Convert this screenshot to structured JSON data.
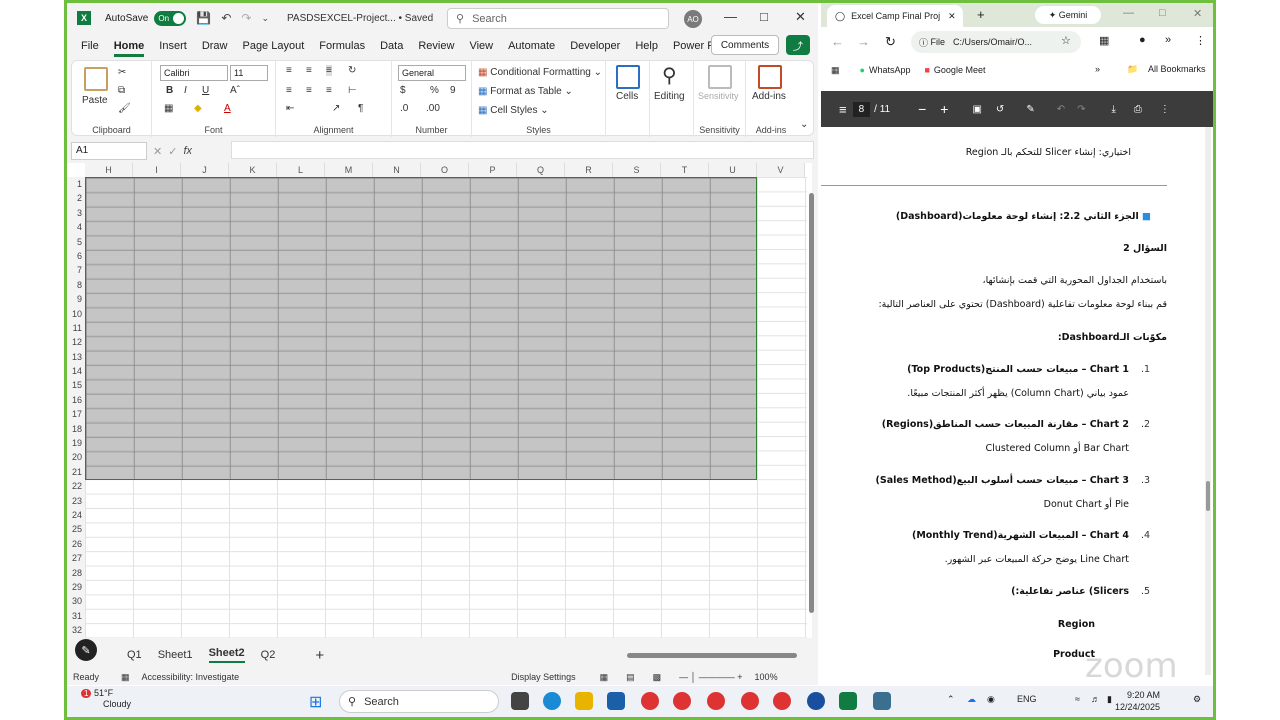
{
  "excel": {
    "autosave_label": "AutoSave",
    "autosave_state": "On",
    "doc_title": "PASDSEXCEL-Project... • Saved",
    "search_placeholder": "Search",
    "avatar_initials": "AO",
    "menu": [
      "File",
      "Home",
      "Insert",
      "Draw",
      "Page Layout",
      "Formulas",
      "Data",
      "Review",
      "View",
      "Automate",
      "Developer",
      "Help",
      "Power Pivot"
    ],
    "comments_label": "Comments",
    "ribbon": {
      "paste": "Paste",
      "clipboard": "Clipboard",
      "font_name": "Calibri",
      "font_size": "11",
      "font": "Font",
      "alignment": "Alignment",
      "number_format": "General",
      "number": "Number",
      "conditional_formatting": "Conditional Formatting",
      "format_as_table": "Format as Table",
      "cell_styles": "Cell Styles",
      "styles": "Styles",
      "cells": "Cells",
      "editing": "Editing",
      "sensitivity": "Sensitivity",
      "sensitivity_group": "Sensitivity",
      "addins": "Add-ins",
      "addins_group": "Add-ins"
    },
    "name_box": "A1",
    "fx": "fx",
    "columns": [
      "H",
      "I",
      "J",
      "K",
      "L",
      "M",
      "N",
      "O",
      "P",
      "Q",
      "R",
      "S",
      "T",
      "U",
      "V"
    ],
    "rows": [
      "1",
      "2",
      "3",
      "4",
      "5",
      "6",
      "7",
      "8",
      "9",
      "10",
      "11",
      "12",
      "13",
      "14",
      "15",
      "16",
      "17",
      "18",
      "19",
      "20",
      "21",
      "22",
      "23",
      "24",
      "25",
      "26",
      "27",
      "28",
      "29",
      "30",
      "31",
      "32"
    ],
    "sheets": [
      "Q1",
      "Sheet1",
      "Sheet2",
      "Q2"
    ],
    "active_sheet": "Sheet2",
    "status_ready": "Ready",
    "accessibility": "Accessibility: Investigate",
    "display_settings": "Display Settings",
    "zoom": "100%"
  },
  "chrome": {
    "tab_title": "Excel Camp Final Proj",
    "gemini": "Gemini",
    "omni_scheme": "File",
    "omni_url": "C:/Users/Omair/O...",
    "bookmarks": [
      "WhatsApp",
      "Google Meet"
    ],
    "all_bookmarks": "All Bookmarks",
    "pdf_page": "8",
    "pdf_total": "/ 11",
    "pdf_lines": [
      "اختياري: إنشاء Slicer للتحكم بالـ Region",
      "الجزء الثاني 2.2: إنشاء لوحة معلومات(Dashboard)",
      "السؤال 2",
      "باستخدام الجداول المحورية التي قمت بإنشائها،",
      "قم ببناء لوحة معلومات تفاعلية (Dashboard) تحتوي على العناصر التالية:",
      "مكوّنات الـDashboard:",
      "Chart 1 – مبيعات حسب المنتج(Top Products)",
      "عمود بياني (Column Chart) يظهر أكثر المنتجات مبيعًا.",
      "Chart 2 – مقارنة المبيعات حسب المناطق(Regions)",
      "Bar Chart أو Clustered Column",
      "Chart 3 – مبيعات حسب أسلوب البيع(Sales Method)",
      "Pie أو Donut Chart",
      "Chart 4 – المبيعات الشهرية(Monthly Trend)",
      "Line Chart يوضح حركة المبيعات عبر الشهور.",
      "Slicers) عناصر تفاعلية:)",
      "Region",
      "Product"
    ],
    "pdf_numbers": [
      "1.",
      "2.",
      "3.",
      "4.",
      "5."
    ]
  },
  "taskbar": {
    "temp": "51°F",
    "weather": "Cloudy",
    "badge": "1",
    "search": "Search",
    "lang": "ENG",
    "time": "9:20 AM",
    "date": "12/24/2025"
  },
  "watermark": "zoom"
}
